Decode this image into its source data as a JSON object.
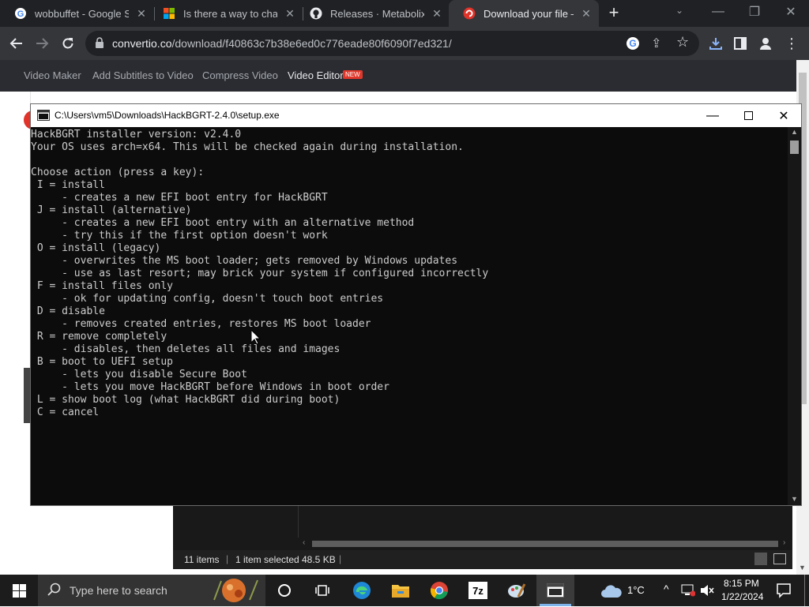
{
  "browser": {
    "tabs": [
      {
        "title": "wobbuffet - Google Se",
        "icon": "google-icon"
      },
      {
        "title": "Is there a way to chang",
        "icon": "microsoft-icon"
      },
      {
        "title": "Releases · Metabolix/H",
        "icon": "github-icon"
      },
      {
        "title": "Download your file — ",
        "icon": "convertio-icon"
      }
    ],
    "url_domain": "convertio.co",
    "url_path": "/download/f40863c7b38e6ed0c776eade80f6090f7ed321/"
  },
  "site_nav": {
    "links": [
      "Video Maker",
      "Add Subtitles to Video",
      "Compress Video",
      "Video Editor"
    ],
    "badge": "NEW"
  },
  "console": {
    "title": "C:\\Users\\vm5\\Downloads\\HackBGRT-2.4.0\\setup.exe",
    "lines": [
      "HackBGRT installer version: v2.4.0",
      "Your OS uses arch=x64. This will be checked again during installation.",
      "",
      "Choose action (press a key):",
      " I = install",
      "     - creates a new EFI boot entry for HackBGRT",
      " J = install (alternative)",
      "     - creates a new EFI boot entry with an alternative method",
      "     - try this if the first option doesn't work",
      " O = install (legacy)",
      "     - overwrites the MS boot loader; gets removed by Windows updates",
      "     - use as last resort; may brick your system if configured incorrectly",
      " F = install files only",
      "     - ok for updating config, doesn't touch boot entries",
      " D = disable",
      "     - removes created entries, restores MS boot loader",
      " R = remove completely",
      "     - disables, then deletes all files and images",
      " B = boot to UEFI setup",
      "     - lets you disable Secure Boot",
      "     - lets you move HackBGRT before Windows in boot order",
      " L = show boot log (what HackBGRT did during boot)",
      " C = cancel"
    ]
  },
  "explorer": {
    "item_count": "11 items",
    "selection": "1 item selected",
    "size": "48.5 KB"
  },
  "taskbar": {
    "search_placeholder": "Type here to search",
    "weather": "1°C",
    "time": "8:15 PM",
    "date": "1/22/2024"
  }
}
